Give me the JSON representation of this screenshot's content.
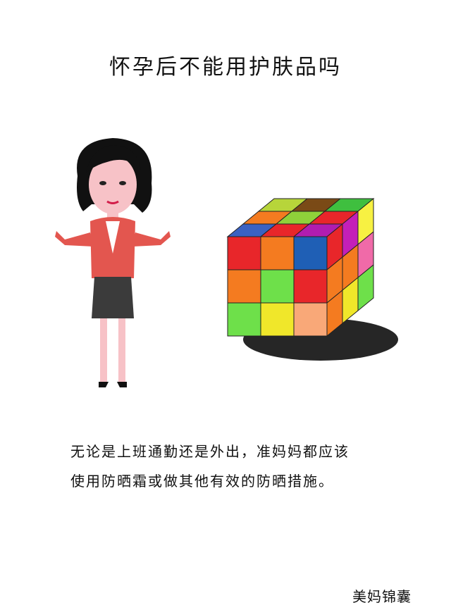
{
  "title": "怀孕后不能用护肤品吗",
  "body_lines": [
    "无论是上班通勤还是外出，准妈妈都应该",
    "使用防晒霜或做其他有效的防晒措施。"
  ],
  "signature": "美妈锦囊",
  "illustrations": {
    "woman": "cartoon-woman-illustration",
    "cube": "rubiks-cube-illustration"
  },
  "cube_colors": {
    "front": [
      "#e8262a",
      "#f47b20",
      "#1f5fb5",
      "#f47b20",
      "#6ee04a",
      "#e8262a",
      "#6ee04a",
      "#f0e72a",
      "#f9a878"
    ],
    "top": [
      "#b7d53a",
      "#7a4a16",
      "#3fbf3f",
      "#f47b20",
      "#8fd13a",
      "#e8262a",
      "#3a62c2",
      "#e8262a",
      "#b01db0"
    ],
    "right": [
      "#e8262a",
      "#c41fb8",
      "#f7f142",
      "#f47b20",
      "#f47b20",
      "#f06aa8",
      "#f47b20",
      "#f0e72a",
      "#6ee04a"
    ]
  }
}
